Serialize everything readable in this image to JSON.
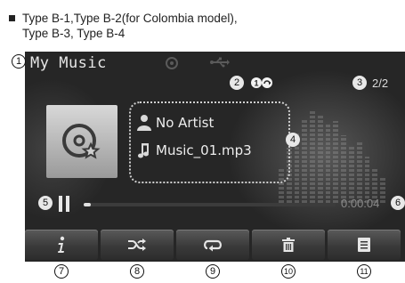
{
  "caption": {
    "line1": "Type B-1,Type B-2(for Colombia model),",
    "line2": "Type B-3, Type B-4"
  },
  "screen": {
    "title": "My Music",
    "mode_icons": [
      "disc-icon",
      "usb-icon"
    ],
    "repeat_indicator": "repeat-one-icon",
    "track_count": "2/2",
    "artist": "No Artist",
    "filename": "Music_01.mp3",
    "elapsed_time": "0:00:04",
    "progress_fraction": 0.02,
    "buttons": [
      {
        "name": "info-button",
        "icon": "info-icon"
      },
      {
        "name": "shuffle-button",
        "icon": "shuffle-icon"
      },
      {
        "name": "repeat-button",
        "icon": "repeat-icon"
      },
      {
        "name": "delete-button",
        "icon": "trash-icon"
      },
      {
        "name": "list-button",
        "icon": "list-icon"
      }
    ]
  },
  "callouts": [
    "1",
    "2",
    "3",
    "4",
    "5",
    "6",
    "7",
    "8",
    "9",
    "10",
    "11"
  ],
  "colors": {
    "screen_bg": "#262626",
    "button_face": "#4a4a4a",
    "text_primary": "#ededed",
    "text_dim": "#8a8a8a"
  }
}
